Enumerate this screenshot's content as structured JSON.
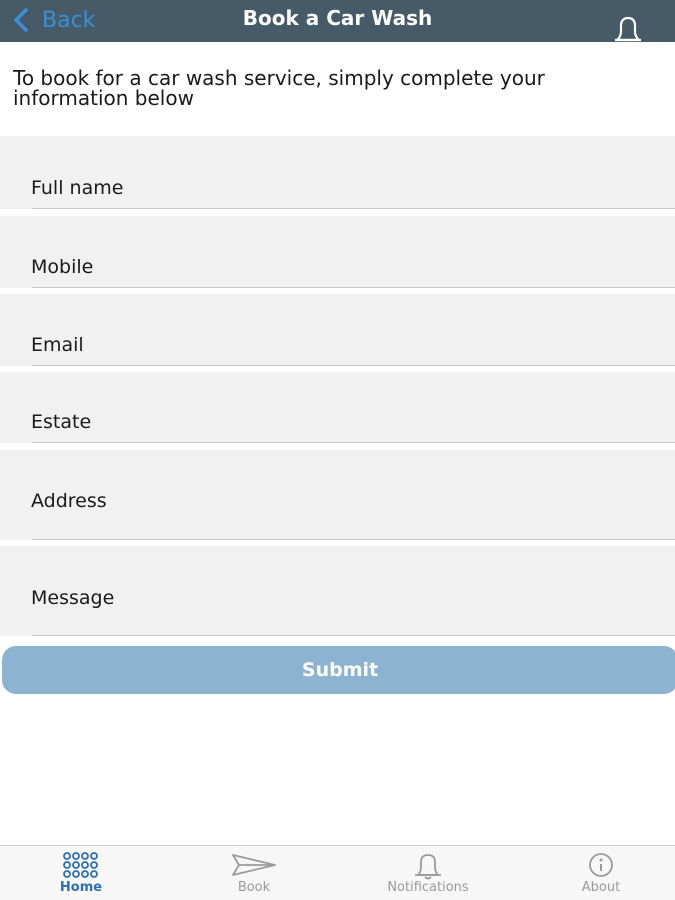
{
  "header": {
    "back_label": "Back",
    "title": "Book a Car Wash",
    "right_icon": "bell-icon"
  },
  "intro_text": "To book for a car wash service, simply complete your information below",
  "form": {
    "fields": [
      {
        "placeholder": "Full name",
        "value": ""
      },
      {
        "placeholder": "Mobile",
        "value": ""
      },
      {
        "placeholder": "Email",
        "value": ""
      },
      {
        "placeholder": "Estate",
        "value": ""
      },
      {
        "placeholder": "Address",
        "value": ""
      },
      {
        "placeholder": "Message",
        "value": ""
      }
    ],
    "submit_label": "Submit"
  },
  "tabbar": {
    "tabs": [
      {
        "label": "Home",
        "icon": "grid-icon",
        "active": true
      },
      {
        "label": "Book",
        "icon": "send-icon",
        "active": false
      },
      {
        "label": "Notifications",
        "icon": "bell-icon",
        "active": false
      },
      {
        "label": "About",
        "icon": "info-icon",
        "active": false
      }
    ]
  },
  "colors": {
    "header_bg": "#465a68",
    "back_link": "#3a8fd9",
    "field_bg": "#f1f1f1",
    "submit_bg": "#8cb3d0",
    "tab_active": "#2c6fb4",
    "tab_inactive": "#9a9a9a"
  }
}
